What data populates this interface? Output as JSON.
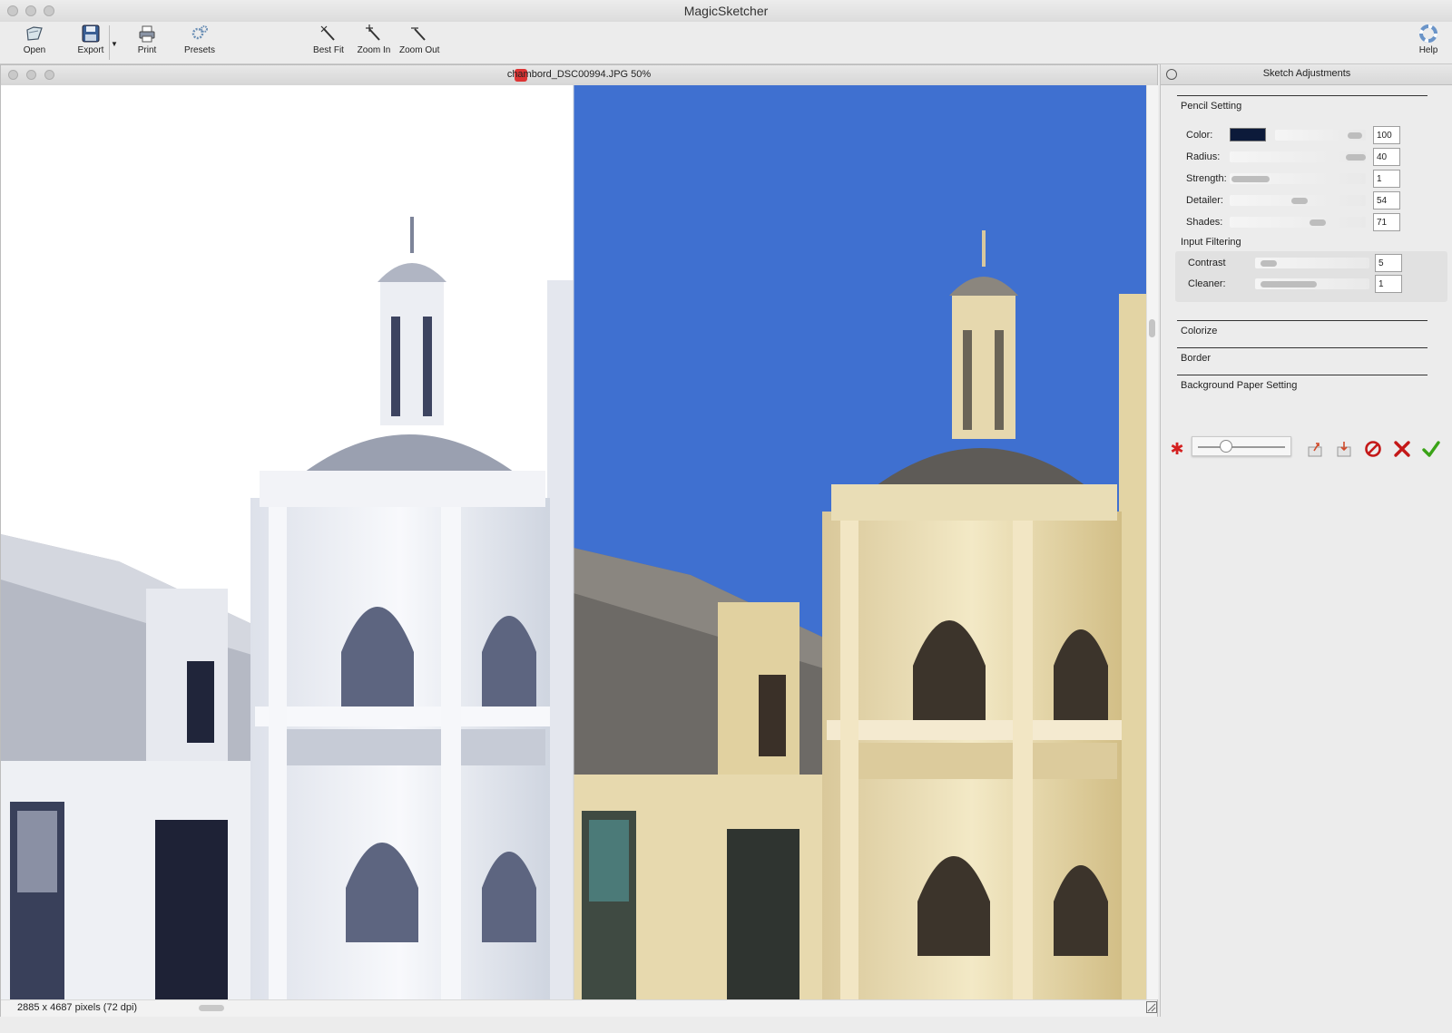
{
  "app": {
    "title": "MagicSketcher"
  },
  "toolbar": {
    "open": "Open",
    "export": "Export",
    "print": "Print",
    "presets": "Presets",
    "best_fit": "Best Fit",
    "zoom_in": "Zoom In",
    "zoom_out": "Zoom Out",
    "help": "Help"
  },
  "document": {
    "title": "chambord_DSC00994.JPG 50%",
    "status": "2885 x 4687 pixels (72 dpi)"
  },
  "panel": {
    "title": "Sketch Adjustments",
    "pencil_section": "Pencil Setting",
    "color_label": "Color:",
    "color_value": "100",
    "pencil_color": "#0c1a3a",
    "radius_label": "Radius:",
    "radius_value": "40",
    "strength_label": "Strength:",
    "strength_value": "1",
    "detailer_label": "Detailer:",
    "detailer_value": "54",
    "shades_label": "Shades:",
    "shades_value": "71",
    "input_filtering": "Input Filtering",
    "contrast_label": "Contrast",
    "contrast_value": "5",
    "cleaner_label": "Cleaner:",
    "cleaner_value": "1",
    "colorize_section": "Colorize",
    "border_section": "Border",
    "background_section": "Background Paper Setting"
  },
  "colors": {
    "sky": "#3d6fcf",
    "accent_red": "#d42020",
    "accent_green": "#3aa317"
  }
}
